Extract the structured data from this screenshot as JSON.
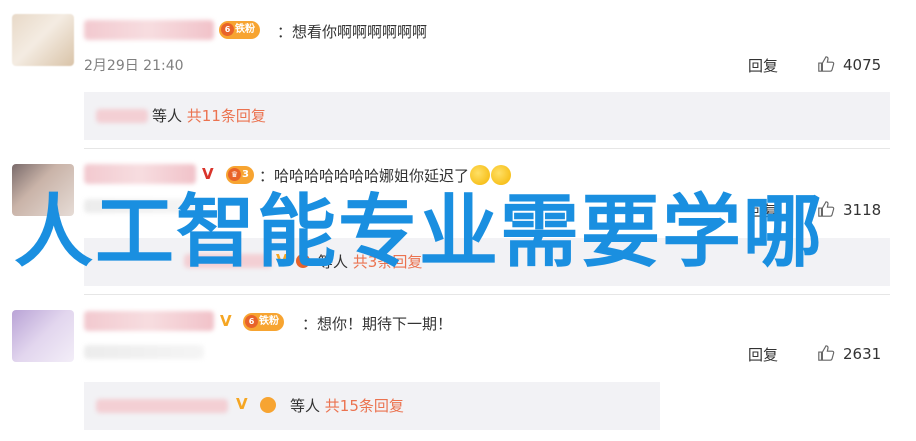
{
  "comments": [
    {
      "badge": "铁粉",
      "text": "：想看你啊啊啊啊啊啊",
      "time": "2月29日 21:40",
      "reply_label": "回复",
      "likes": "4075",
      "replies": {
        "prefix": "等人",
        "link": "共11条回复"
      }
    },
    {
      "badge_number": "3",
      "vip": "V",
      "text": "：哈哈哈哈哈哈哈娜姐你延迟了",
      "reply_label": "回复",
      "likes": "3118",
      "replies": {
        "prefix": "等人",
        "link": "共3条回复"
      }
    },
    {
      "vip": "V",
      "badge": "铁粉",
      "text": "：想你！期待下一期！",
      "reply_label": "回复",
      "likes": "2631",
      "replies": {
        "prefix": "等人",
        "link": "共15条回复"
      }
    }
  ],
  "overlay_title": "人工智能专业需要学哪",
  "colors": {
    "link": "#eb7350",
    "overlay": "#1a8fe0",
    "vip": "#f5a623"
  },
  "icons": [
    "thumbs-up-icon",
    "fan-crown-icon",
    "vip-v-icon",
    "laughing-emoji-icon"
  ]
}
